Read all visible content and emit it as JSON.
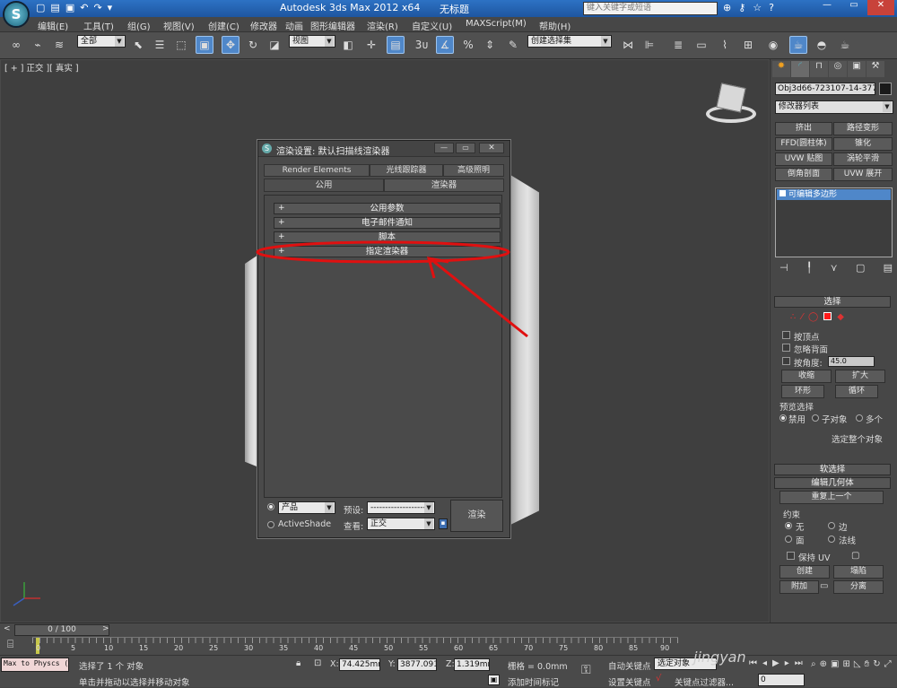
{
  "window": {
    "app_title": "Autodesk 3ds Max  2012 x64",
    "doc_title": "无标题",
    "search_placeholder": "键入关键字或短语"
  },
  "menu": [
    "编辑(E)",
    "工具(T)",
    "组(G)",
    "视图(V)",
    "创建(C)",
    "修改器",
    "动画",
    "图形编辑器",
    "渲染(R)",
    "自定义(U)",
    "MAXScript(M)",
    "帮助(H)"
  ],
  "toolbar": {
    "selection_filter": "全部",
    "ref_coord": "视图",
    "named_selection": "创建选择集",
    "snap_label": "3",
    "percent_label": "%"
  },
  "viewport": {
    "label": "[ + ] 正交 ][ 真实 ]"
  },
  "command_panel": {
    "object_name": "Obj3d66-723107-14-377",
    "modifier_list": "修改器列表",
    "mod_buttons": [
      "挤出",
      "路径变形",
      "FFD(圆柱体)",
      "锥化",
      "UVW 贴图",
      "涡轮平滑",
      "倒角剖面",
      "UVW 展开"
    ],
    "stack_item": "可编辑多边形",
    "selection_rollout": "选择",
    "by_vertex": "按顶点",
    "ignore_backfacing": "忽略背面",
    "by_angle": "按角度:",
    "angle_value": "45.0",
    "shrink": "收缩",
    "grow": "扩大",
    "ring": "环形",
    "loop": "循环",
    "preview_selection": "预览选择",
    "preview_options": [
      "禁用",
      "子对象",
      "多个"
    ],
    "whole_object": "选定整个对象",
    "soft_selection": "软选择",
    "edit_geometry": "编辑几何体",
    "repeat_last": "重复上一个",
    "constraints": "约束",
    "constraint_options": [
      "无",
      "边",
      "面",
      "法线"
    ],
    "preserve_uv": "保持 UV",
    "create": "创建",
    "collapse": "塌陷",
    "attach": "附加",
    "detach": "分离"
  },
  "dialog": {
    "title": "渲染设置: 默认扫描线渲染器",
    "tabs_row1": [
      "Render Elements",
      "光线跟踪器",
      "高级照明"
    ],
    "tabs_row2": [
      "公用",
      "渲染器"
    ],
    "rollouts": [
      "公用参数",
      "电子邮件通知",
      "脚本",
      "指定渲染器"
    ],
    "mode_options": [
      "产品",
      "ActiveShade"
    ],
    "preset_label": "预设:",
    "preset_value": "--------------------",
    "view_label": "查看:",
    "view_value": "正交",
    "render_button": "渲染"
  },
  "timeline": {
    "frame_range": "0 / 100",
    "ticks": [
      "0",
      "5",
      "10",
      "15",
      "20",
      "25",
      "30",
      "35",
      "40",
      "45",
      "50",
      "55",
      "60",
      "65",
      "70",
      "75",
      "80",
      "85",
      "90"
    ]
  },
  "status": {
    "mini_listener": "Max to Physcs (",
    "selected_text": "选择了 1 个 对象",
    "prompt_text": "单击并拖动以选择并移动对象",
    "x_label": "X:",
    "x_value": "74.425mm",
    "y_label": "Y:",
    "y_value": "3877.091m",
    "z_label": "Z:",
    "z_value": "1.319mm",
    "grid": "栅格 = 0.0mm",
    "add_time_tag": "添加时间标记",
    "auto_key": "自动关键点",
    "set_key": "设置关键点",
    "selected_set": "选定对象",
    "key_filters": "关键点过滤器...",
    "frame_value": "0",
    "watermark": "jingyan"
  },
  "colors": {
    "accent_blue": "#4f87c9",
    "annotation_red": "#e01010",
    "selection_red": "#ff1a1a"
  }
}
